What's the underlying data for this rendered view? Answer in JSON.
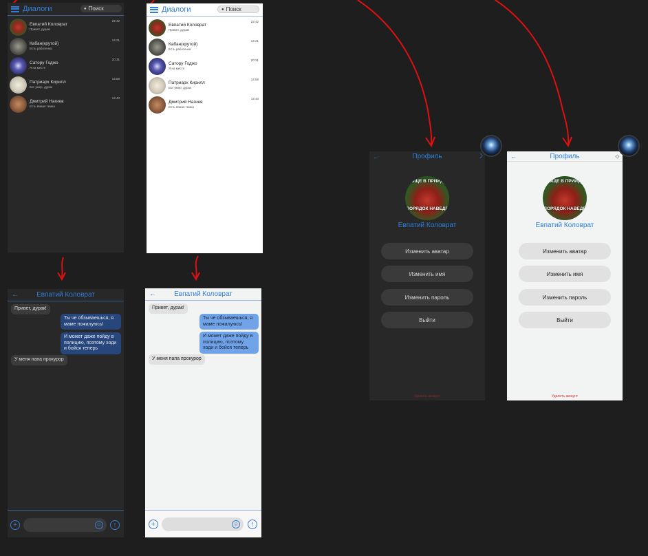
{
  "dialogs": {
    "title": "Диалоги",
    "search_label": "Поиск",
    "items": [
      {
        "name": "Евпатий Коловрат",
        "message": "Привет, дурак!",
        "time": "22:42",
        "avatar_color": "#8a2a1e"
      },
      {
        "name": "Кабан(крутой)",
        "message": "Есть работенка",
        "time": "14:21",
        "avatar_color": "#50504a"
      },
      {
        "name": "Сатору Годжо",
        "message": "Я на месте",
        "time": "20:31",
        "avatar_color": "#2d2d6b"
      },
      {
        "name": "Патриарх Кирилл",
        "message": "Бог умер, дурак",
        "time": "14:58",
        "avatar_color": "#cfc8b8"
      },
      {
        "name": "Дмитрий Нагиев",
        "message": "Есть ёмкая темка",
        "time": "14:43",
        "avatar_color": "#8a5a3c"
      }
    ]
  },
  "chat": {
    "title": "Евпатий Коловрат",
    "messages": [
      {
        "text": "Привет, дурак!",
        "direction": "in"
      },
      {
        "text": "Ты че обзываешься, я маме пожалуюсь!",
        "direction": "out"
      },
      {
        "text": "И может даже пойду в полицию, поэтому ходи и бойся теперь",
        "direction": "out"
      },
      {
        "text": "У меня папа прокурор",
        "direction": "in"
      }
    ],
    "add_icon": "+",
    "emoji_icon": "☺",
    "send_icon": "↑"
  },
  "profile": {
    "title": "Профиль",
    "name": "Евпатий Коловрат",
    "avatar_text_top": "РОЩЕ В ПРИЙДЕ",
    "avatar_text_bottom": "ПОРЯДОК НАВЕДЕ",
    "buttons": [
      "Изменить аватар",
      "Изменить имя",
      "Изменить пароль",
      "Выйти"
    ],
    "delete_label": "Удалить аккаунт",
    "dark_mode_icon": "☽",
    "light_mode_icon": "☼"
  },
  "colors": {
    "accent": "#2f7fd8",
    "background": "#1e1e1e",
    "dark_panel": "#282828",
    "arrow": "#e01010",
    "out_bubble_dark": "#27467b",
    "out_bubble_light": "#71a3e9",
    "danger": "#d13030"
  }
}
